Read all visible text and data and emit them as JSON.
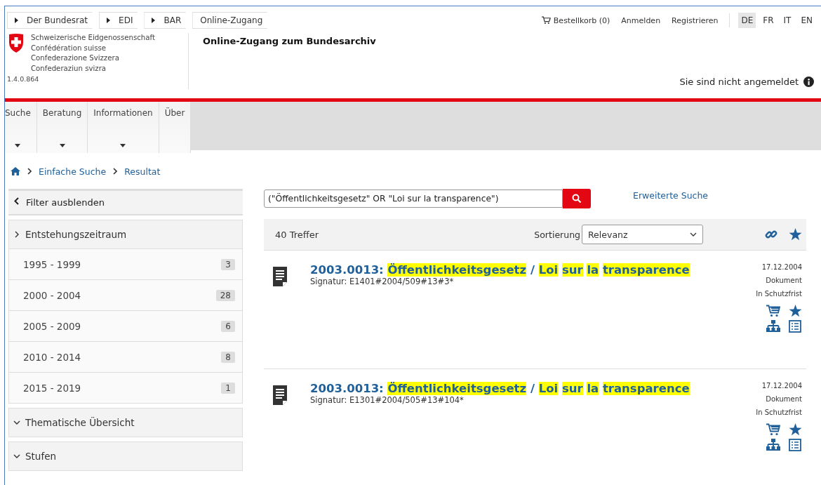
{
  "top_breadcrumb": [
    {
      "label": "Der Bundesrat",
      "arrow": true
    },
    {
      "label": "EDI",
      "arrow": true
    },
    {
      "label": "BAR",
      "arrow": true
    },
    {
      "label": "Online-Zugang",
      "arrow": false
    }
  ],
  "top_links": {
    "cart": "Bestellkorb (0)",
    "login": "Anmelden",
    "register": "Registrieren"
  },
  "languages": [
    {
      "label": "DE",
      "selected": true
    },
    {
      "label": "FR",
      "selected": false
    },
    {
      "label": "IT",
      "selected": false
    },
    {
      "label": "EN",
      "selected": false
    }
  ],
  "logo_lines": [
    "Schweizerische Eidgenossenschaft",
    "Confédération suisse",
    "Confederazione Svizzera",
    "Confederaziun svizra"
  ],
  "version": "1.4.0.864",
  "site_title": "Online-Zugang zum Bundesarchiv",
  "login_status": "Sie sind nicht angemeldet",
  "nav": [
    {
      "label": "Suche",
      "dropdown": true
    },
    {
      "label": "Beratung",
      "dropdown": true
    },
    {
      "label": "Informationen",
      "dropdown": true
    },
    {
      "label": "Über",
      "dropdown": false
    }
  ],
  "breadcrumb": [
    "Einfache Suche",
    "Resultat"
  ],
  "sidebar": {
    "toggle": "Filter ausblenden",
    "sections": [
      {
        "label": "Entstehungszeitraum",
        "expanded": true,
        "items": [
          {
            "label": "1995 - 1999",
            "count": "3"
          },
          {
            "label": "2000 - 2004",
            "count": "28"
          },
          {
            "label": "2005 - 2009",
            "count": "6"
          },
          {
            "label": "2010 - 2014",
            "count": "8"
          },
          {
            "label": "2015 - 2019",
            "count": "1"
          }
        ]
      },
      {
        "label": "Thematische Übersicht",
        "expanded": false
      },
      {
        "label": "Stufen",
        "expanded": false
      }
    ]
  },
  "search": {
    "value": "(\"Öffentlichkeitsgesetz\" OR \"Loi sur la transparence\")",
    "advanced": "Erweiterte Suche"
  },
  "results_bar": {
    "count": "40 Treffer",
    "sort_label": "Sortierung",
    "sort_value": "Relevanz"
  },
  "results": [
    {
      "title": [
        {
          "text": "2003.0013:",
          "highlighted": false
        },
        {
          "text": "Öffentlichkeitsgesetz",
          "highlighted": true
        },
        {
          "text": "/",
          "highlighted": false
        },
        {
          "text": "Loi",
          "highlighted": true
        },
        {
          "text": "sur",
          "highlighted": true
        },
        {
          "text": "la",
          "highlighted": true
        },
        {
          "text": "transparence",
          "highlighted": true
        }
      ],
      "signature": "Signatur: E1401#2004/509#13#3*",
      "date": "17.12.2004",
      "type": "Dokument",
      "status": "In Schutzfrist"
    },
    {
      "title": [
        {
          "text": "2003.0013:",
          "highlighted": false
        },
        {
          "text": "Öffentlichkeitsgesetz",
          "highlighted": true
        },
        {
          "text": "/",
          "highlighted": false
        },
        {
          "text": "Loi",
          "highlighted": true
        },
        {
          "text": "sur",
          "highlighted": true
        },
        {
          "text": "la",
          "highlighted": true
        },
        {
          "text": "transparence",
          "highlighted": true
        }
      ],
      "signature": "Signatur: E1301#2004/505#13#104*",
      "date": "17.12.2004",
      "type": "Dokument",
      "status": "In Schutzfrist"
    }
  ]
}
